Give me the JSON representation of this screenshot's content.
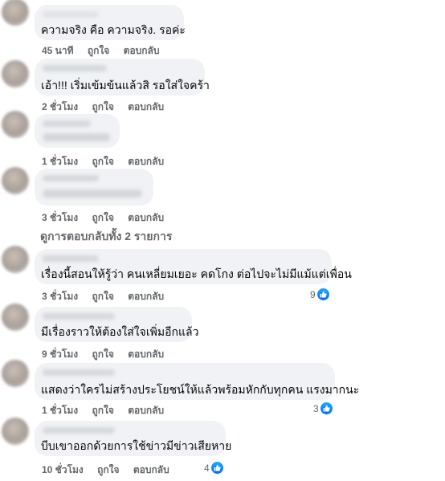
{
  "comments": [
    {
      "text": "ความจริง คือ ความจริง. รอค่ะ",
      "time": "45 นาที",
      "like": "ถูกใจ",
      "reply": "ตอบกลับ",
      "reactions": ""
    },
    {
      "text": "เอ้า!!! เริ่มเข้มข้นแล้วสิ รอใส่ใจคร้า",
      "time": "2 ชั่วโมง",
      "like": "ถูกใจ",
      "reply": "ตอบกลับ",
      "reactions": ""
    },
    {
      "text": "",
      "time": "1 ชั่วโมง",
      "like": "ถูกใจ",
      "reply": "ตอบกลับ",
      "reactions": ""
    },
    {
      "text": "",
      "time": "3 ชั่วโมง",
      "like": "ถูกใจ",
      "reply": "ตอบกลับ",
      "reactions": ""
    },
    {
      "text": "เรื่องนี้สอนให้รู้ว่า คนเหลี่ยมเยอะ คดโกง ต่อไปจะไม่มีแม้แต่เพื่อน",
      "time": "3 ชั่วโมง",
      "like": "ถูกใจ",
      "reply": "ตอบกลับ",
      "reactions": "9"
    },
    {
      "text": "มีเรื่องราวให้ต้องใส่ใจเพิ่มอีกแล้ว",
      "time": "9 ชั่วโมง",
      "like": "ถูกใจ",
      "reply": "ตอบกลับ",
      "reactions": ""
    },
    {
      "text": "แสดงว่าใครไม่สร้างประโยชน์ให้แล้วพร้อมหักกับทุกคน แรงมากนะ",
      "time": "1 ชั่วโมง",
      "like": "ถูกใจ",
      "reply": "ตอบกลับ",
      "reactions": "3"
    },
    {
      "text": "บีบเขาออกด้วยการใช้ข่าวมีข่าวเสียหาย",
      "time": "10 ชั่วโมง",
      "like": "ถูกใจ",
      "reply": "ตอบกลับ",
      "reactions": "4"
    }
  ],
  "view_replies": "ดูการตอบกลับทั้ง 2 รายการ",
  "colors": {
    "bubble": "#f0f2f5",
    "meta": "#65676b",
    "like_blue": "#0866ff"
  }
}
